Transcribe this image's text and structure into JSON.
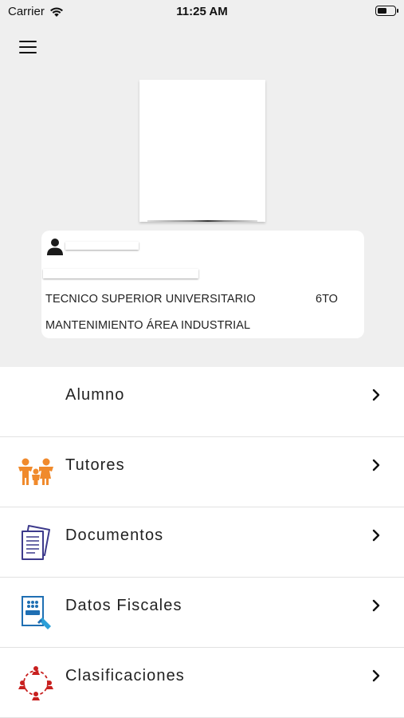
{
  "status_bar": {
    "carrier": "Carrier",
    "time": "11:25 AM",
    "battery_level": 0.55
  },
  "header": {
    "menu_icon": "hamburger-menu-icon"
  },
  "profile": {
    "person_icon": "person-icon",
    "program": "TECNICO SUPERIOR UNIVERSITARIO",
    "grade": "6TO",
    "career": "MANTENIMIENTO ÁREA INDUSTRIAL"
  },
  "menu": {
    "items": [
      {
        "label": "Alumno",
        "icon": ""
      },
      {
        "label": "Tutores",
        "icon": "family-icon",
        "color": "#f08a2c"
      },
      {
        "label": "Documentos",
        "icon": "documents-icon",
        "color": "#3d3a8c"
      },
      {
        "label": "Datos Fiscales",
        "icon": "sat-icon",
        "color": "#1f6fb3"
      },
      {
        "label": "Clasificaciones",
        "icon": "network-people-icon",
        "color": "#c8201f"
      }
    ],
    "chevron_icon": "chevron-right-icon"
  }
}
